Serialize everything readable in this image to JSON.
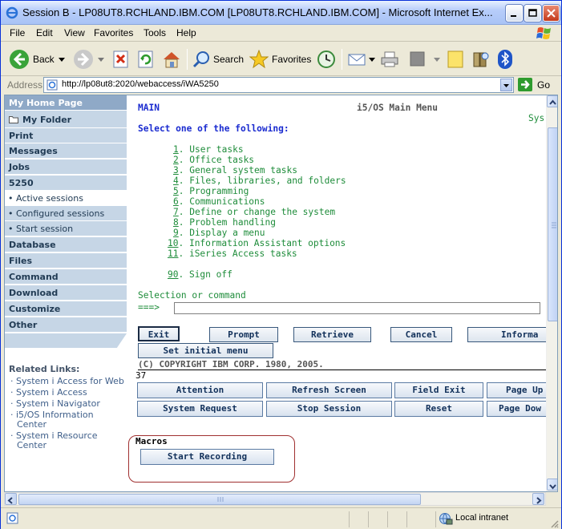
{
  "window": {
    "title": "Session B - LP08UT8.RCHLAND.IBM.COM [LP08UT8.RCHLAND.IBM.COM] - Microsoft Internet Ex..."
  },
  "menubar": [
    "File",
    "Edit",
    "View",
    "Favorites",
    "Tools",
    "Help"
  ],
  "toolbar": {
    "back_label": "Back",
    "search_label": "Search",
    "favorites_label": "Favorites"
  },
  "address": {
    "label": "Address",
    "url": "http://lp08ut8:2020/webaccess/iWA5250",
    "go_label": "Go"
  },
  "sidebar": {
    "items": [
      {
        "label": "My Home Page"
      },
      {
        "label": "My Folder"
      },
      {
        "label": "Print"
      },
      {
        "label": "Messages"
      },
      {
        "label": "Jobs"
      },
      {
        "label": "5250"
      },
      {
        "label": "• Active sessions"
      },
      {
        "label": "• Configured sessions"
      },
      {
        "label": "• Start session"
      },
      {
        "label": "Database"
      },
      {
        "label": "Files"
      },
      {
        "label": "Command"
      },
      {
        "label": "Download"
      },
      {
        "label": "Customize"
      },
      {
        "label": "Other"
      }
    ],
    "related_heading": "Related Links:",
    "related_links": [
      "System i Access for Web",
      "System i Access",
      "System i Navigator",
      "i5/OS Information Center",
      "System i Resource Center"
    ]
  },
  "terminal": {
    "screen_id": "MAIN",
    "screen_title": "i5/OS Main Menu",
    "system_partial": "Sys",
    "instruction": "Select one of the following:",
    "options": [
      {
        "num": "1",
        "text": ". User tasks"
      },
      {
        "num": "2",
        "text": ". Office tasks"
      },
      {
        "num": "3",
        "text": ". General system tasks"
      },
      {
        "num": "4",
        "text": ". Files, libraries, and folders"
      },
      {
        "num": "5",
        "text": ". Programming"
      },
      {
        "num": "6",
        "text": ". Communications"
      },
      {
        "num": "7",
        "text": ". Define or change the system"
      },
      {
        "num": "8",
        "text": ". Problem handling"
      },
      {
        "num": "9",
        "text": ". Display a menu"
      },
      {
        "num": "10",
        "text": ". Information Assistant options"
      },
      {
        "num": "11",
        "text": ". iSeries Access tasks"
      },
      {
        "num": "90",
        "text": ". Sign off"
      }
    ],
    "selection_label": "Selection or command",
    "prompt_arrow": "===>",
    "command_value": "",
    "fkeys": [
      "Exit",
      "Prompt",
      "Retrieve",
      "Cancel",
      "Informa",
      "Set initial menu"
    ],
    "copyright": "(C) COPYRIGHT IBM CORP. 1980, 2005.",
    "cursor_pos": "37",
    "keys_row1": [
      "Attention",
      "Refresh Screen",
      "Field Exit",
      "Page Up"
    ],
    "keys_row2": [
      "System Request",
      "Stop Session",
      "Reset",
      "Page Dow"
    ],
    "macros_heading": "Macros",
    "start_recording": "Start Recording"
  },
  "status": {
    "zone": "Local intranet"
  },
  "colors": {
    "sidebar_bg": "#c6d6e6",
    "sidebar_home": "#8fa9c7",
    "term_blue": "#1a2bd0",
    "term_green": "#1e8c3a"
  }
}
